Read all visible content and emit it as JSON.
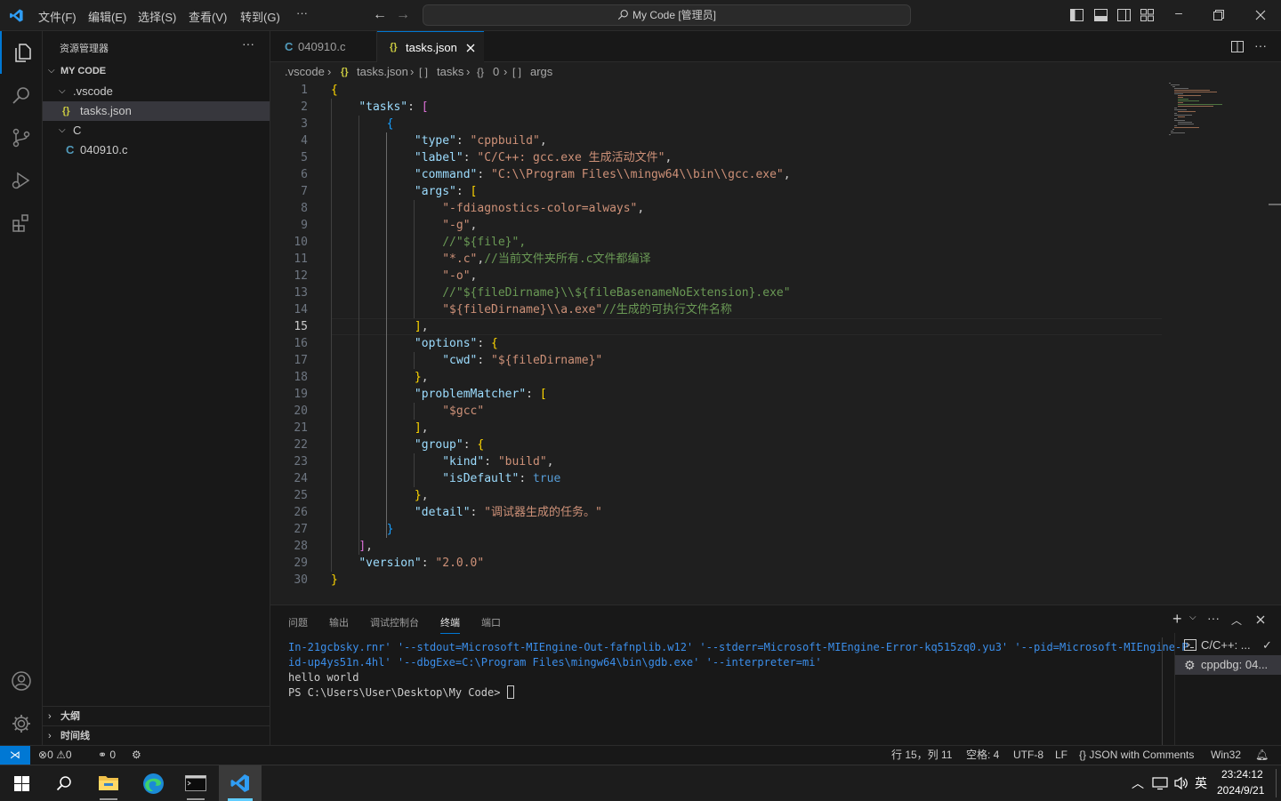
{
  "titlebar": {
    "menus": [
      "文件(F)",
      "编辑(E)",
      "选择(S)",
      "查看(V)",
      "转到(G)",
      "···"
    ],
    "search": "My Code [管理员]"
  },
  "sidebar": {
    "title": "资源管理器",
    "more": "···",
    "root": "MY CODE",
    "items": [
      {
        "label": ".vscode",
        "icon": "chevron-down-icon"
      },
      {
        "label": "tasks.json",
        "icon": "{}"
      },
      {
        "label": "C",
        "icon": "chevron-down-icon"
      },
      {
        "label": "040910.c",
        "icon": "C"
      }
    ],
    "outline": "大纲",
    "timeline": "时间线"
  },
  "tabs": [
    {
      "label": "040910.c",
      "icon": "C",
      "active": false
    },
    {
      "label": "tasks.json",
      "icon": "{}",
      "active": true
    }
  ],
  "breadcrumb": [
    ".vscode",
    "tasks.json",
    "tasks",
    "0",
    "args"
  ],
  "breadcrumb_icons": [
    "{}",
    "[ ]",
    "{}",
    "[ ]"
  ],
  "editor": {
    "active_line": 15,
    "line_numbers": [
      "1",
      "2",
      "3",
      "4",
      "5",
      "6",
      "7",
      "8",
      "9",
      "10",
      "11",
      "12",
      "13",
      "14",
      "15",
      "16",
      "17",
      "18",
      "19",
      "20",
      "21",
      "22",
      "23",
      "24",
      "25",
      "26",
      "27",
      "28",
      "29",
      "30"
    ],
    "lines": [
      [
        [
          "b1",
          "{"
        ]
      ],
      [
        [
          "p",
          "    "
        ],
        [
          "k",
          "\"tasks\""
        ],
        [
          "p",
          ": "
        ],
        [
          "b2",
          "["
        ]
      ],
      [
        [
          "p",
          "        "
        ],
        [
          "b3",
          "{"
        ]
      ],
      [
        [
          "p",
          "            "
        ],
        [
          "k",
          "\"type\""
        ],
        [
          "p",
          ": "
        ],
        [
          "s",
          "\"cppbuild\""
        ],
        [
          "p",
          ","
        ]
      ],
      [
        [
          "p",
          "            "
        ],
        [
          "k",
          "\"label\""
        ],
        [
          "p",
          ": "
        ],
        [
          "s",
          "\"C/C++: gcc.exe 生成活动文件\""
        ],
        [
          "p",
          ","
        ]
      ],
      [
        [
          "p",
          "            "
        ],
        [
          "k",
          "\"command\""
        ],
        [
          "p",
          ": "
        ],
        [
          "s",
          "\"C:\\\\Program Files\\\\mingw64\\\\bin\\\\gcc.exe\""
        ],
        [
          "p",
          ","
        ]
      ],
      [
        [
          "p",
          "            "
        ],
        [
          "k",
          "\"args\""
        ],
        [
          "p",
          ": "
        ],
        [
          "b1",
          "["
        ]
      ],
      [
        [
          "p",
          "                "
        ],
        [
          "s",
          "\"-fdiagnostics-color=always\""
        ],
        [
          "p",
          ","
        ]
      ],
      [
        [
          "p",
          "                "
        ],
        [
          "s",
          "\"-g\""
        ],
        [
          "p",
          ","
        ]
      ],
      [
        [
          "p",
          "                "
        ],
        [
          "c",
          "//\"${file}\","
        ]
      ],
      [
        [
          "p",
          "                "
        ],
        [
          "s",
          "\"*.c\""
        ],
        [
          "p",
          ","
        ],
        [
          "c",
          "//当前文件夹所有.c文件都编译"
        ]
      ],
      [
        [
          "p",
          "                "
        ],
        [
          "s",
          "\"-o\""
        ],
        [
          "p",
          ","
        ]
      ],
      [
        [
          "p",
          "                "
        ],
        [
          "c",
          "//\"${fileDirname}\\\\${fileBasenameNoExtension}.exe\""
        ]
      ],
      [
        [
          "p",
          "                "
        ],
        [
          "s",
          "\"${fileDirname}\\\\a.exe\""
        ],
        [
          "c",
          "//生成的可执行文件名称"
        ]
      ],
      [
        [
          "p",
          "            "
        ],
        [
          "b1",
          "]"
        ],
        [
          "p",
          ","
        ]
      ],
      [
        [
          "p",
          "            "
        ],
        [
          "k",
          "\"options\""
        ],
        [
          "p",
          ": "
        ],
        [
          "b1",
          "{"
        ]
      ],
      [
        [
          "p",
          "                "
        ],
        [
          "k",
          "\"cwd\""
        ],
        [
          "p",
          ": "
        ],
        [
          "s",
          "\"${fileDirname}\""
        ]
      ],
      [
        [
          "p",
          "            "
        ],
        [
          "b1",
          "}"
        ],
        [
          "p",
          ","
        ]
      ],
      [
        [
          "p",
          "            "
        ],
        [
          "k",
          "\"problemMatcher\""
        ],
        [
          "p",
          ": "
        ],
        [
          "b1",
          "["
        ]
      ],
      [
        [
          "p",
          "                "
        ],
        [
          "s",
          "\"$gcc\""
        ]
      ],
      [
        [
          "p",
          "            "
        ],
        [
          "b1",
          "]"
        ],
        [
          "p",
          ","
        ]
      ],
      [
        [
          "p",
          "            "
        ],
        [
          "k",
          "\"group\""
        ],
        [
          "p",
          ": "
        ],
        [
          "b1",
          "{"
        ]
      ],
      [
        [
          "p",
          "                "
        ],
        [
          "k",
          "\"kind\""
        ],
        [
          "p",
          ": "
        ],
        [
          "s",
          "\"build\""
        ],
        [
          "p",
          ","
        ]
      ],
      [
        [
          "p",
          "                "
        ],
        [
          "k",
          "\"isDefault\""
        ],
        [
          "p",
          ": "
        ],
        [
          "t",
          "true"
        ]
      ],
      [
        [
          "p",
          "            "
        ],
        [
          "b1",
          "}"
        ],
        [
          "p",
          ","
        ]
      ],
      [
        [
          "p",
          "            "
        ],
        [
          "k",
          "\"detail\""
        ],
        [
          "p",
          ": "
        ],
        [
          "s",
          "\"调试器生成的任务。\""
        ]
      ],
      [
        [
          "p",
          "        "
        ],
        [
          "b3",
          "}"
        ]
      ],
      [
        [
          "p",
          "    "
        ],
        [
          "b2",
          "]"
        ],
        [
          "p",
          ","
        ]
      ],
      [
        [
          "p",
          "    "
        ],
        [
          "k",
          "\"version\""
        ],
        [
          "p",
          ": "
        ],
        [
          "s",
          "\"2.0.0\""
        ]
      ],
      [
        [
          "b1",
          "}"
        ]
      ]
    ]
  },
  "panel": {
    "tabs": [
      "问题",
      "输出",
      "调试控制台",
      "终端",
      "端口"
    ],
    "active_tab": "终端",
    "terminal": [
      "In-21gcbsky.rnr' '--stdout=Microsoft-MIEngine-Out-fafnplib.w12' '--stderr=Microsoft-MIEngine-Error-kq515zq0.yu3' '--pid=Microsoft-MIEngine-P",
      "id-up4ys51n.4hl' '--dbgExe=C:\\Program Files\\mingw64\\bin\\gdb.exe' '--interpreter=mi'",
      "hello world",
      "PS C:\\Users\\User\\Desktop\\My Code> "
    ],
    "terminals": [
      "C/C++: ...",
      "cppdbg: 04..."
    ]
  },
  "statusbar": {
    "errors": "0",
    "warnings": "0",
    "ports": "0",
    "position": "行 15，列 11",
    "spaces": "空格: 4",
    "encoding": "UTF-8",
    "eol": "LF",
    "language": "JSON with Comments",
    "platform": "Win32"
  },
  "taskbar": {
    "time": "23:24:12",
    "date": "2024/9/21",
    "ime": "英"
  },
  "colors": {
    "accent": "#0078d4",
    "background": "#1f1f1f",
    "sidebar": "#181818"
  }
}
